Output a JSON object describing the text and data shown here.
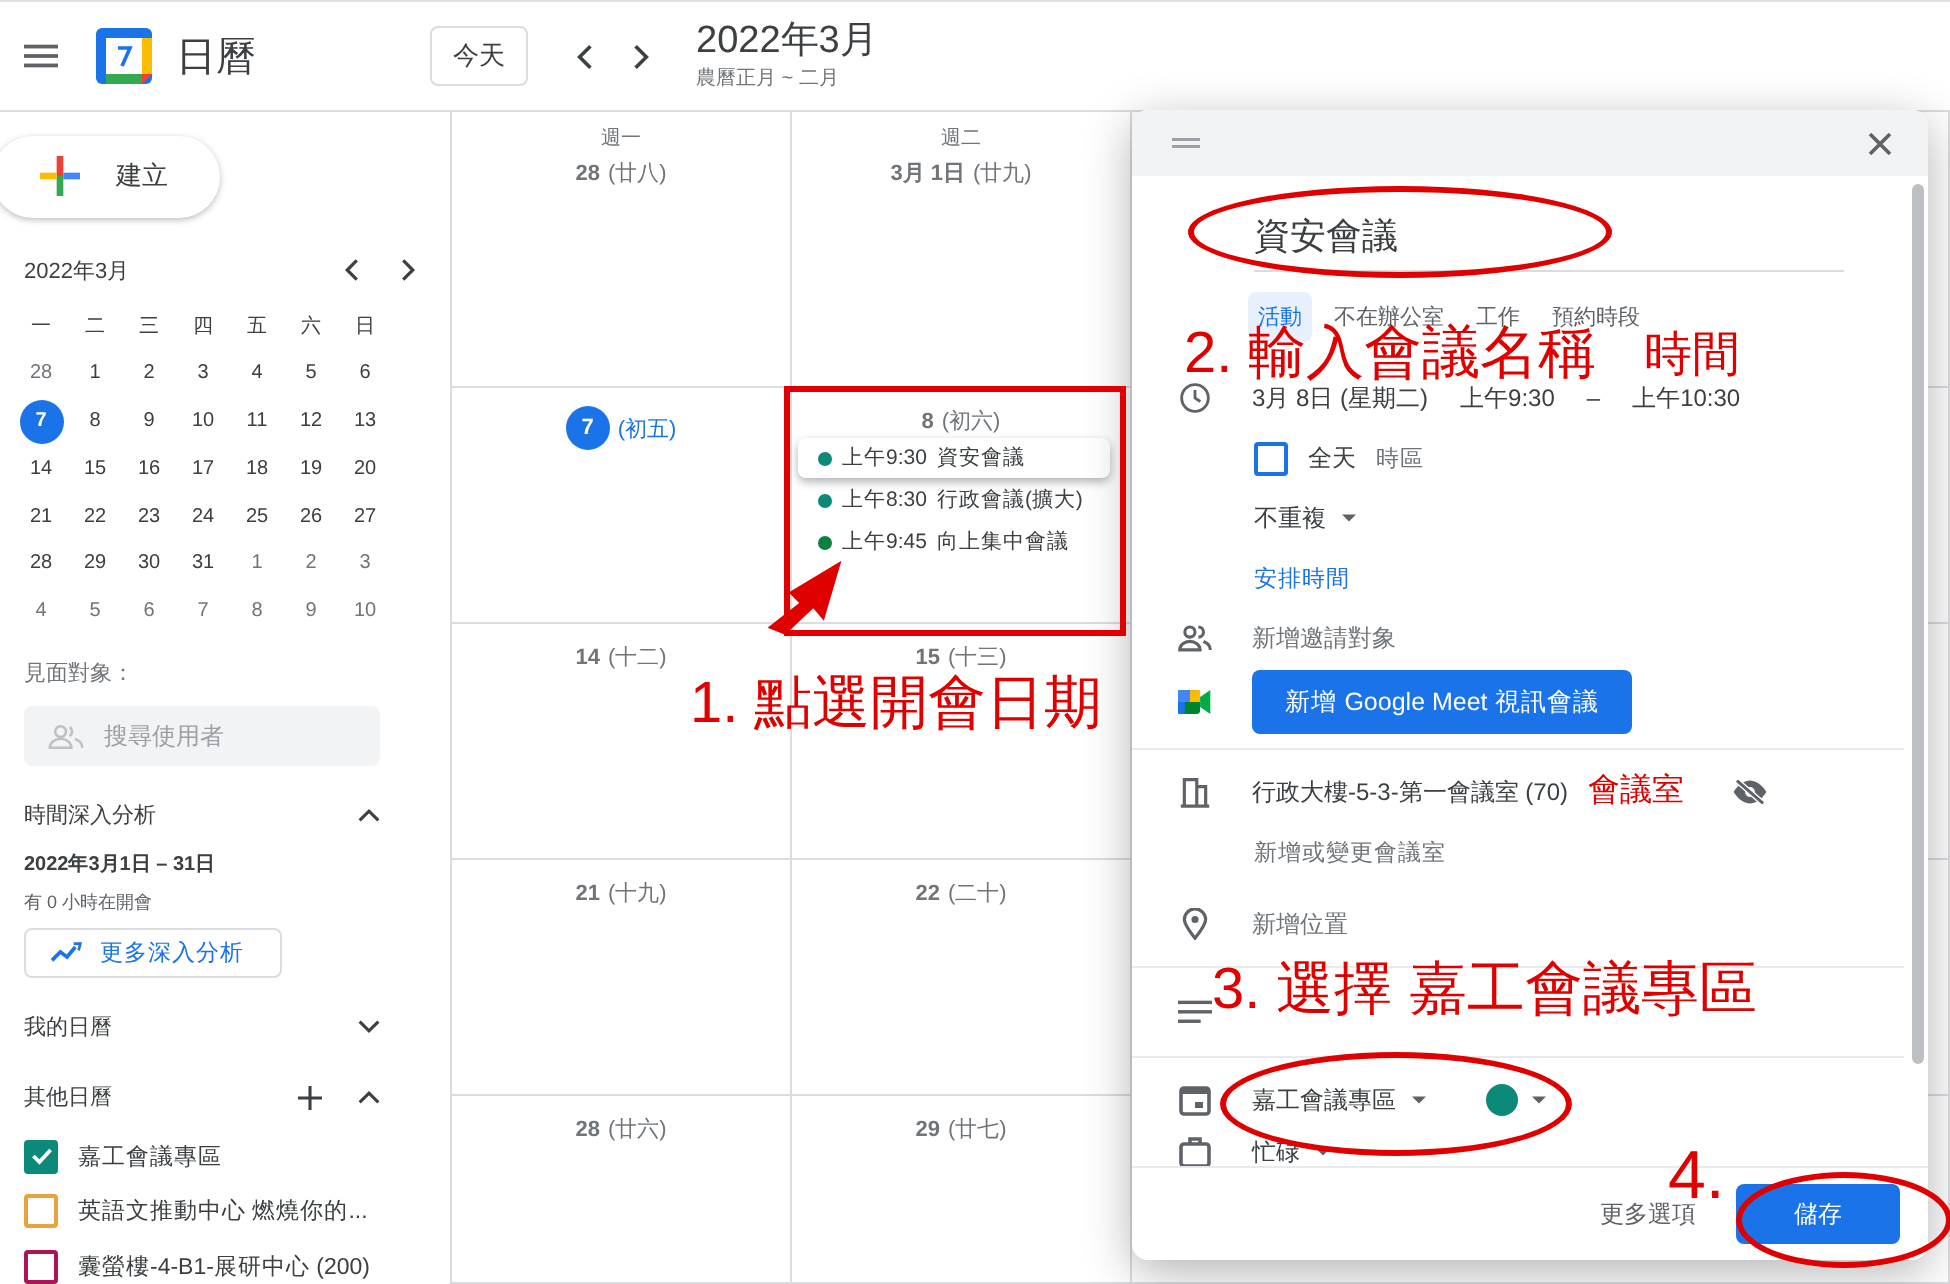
{
  "header": {
    "title": "日曆",
    "today_button": "今天",
    "month": "2022年3月",
    "lunar": "農曆正月 ~ 二月"
  },
  "sidebar": {
    "create_button": "建立",
    "mini_calendar": {
      "title": "2022年3月",
      "weekdays": [
        "一",
        "二",
        "三",
        "四",
        "五",
        "六",
        "日"
      ],
      "weeks": [
        [
          {
            "day": "28",
            "selected": false,
            "muted": true
          },
          {
            "day": "1",
            "selected": false,
            "muted": false
          },
          {
            "day": "2",
            "selected": false,
            "muted": false
          },
          {
            "day": "3",
            "selected": false,
            "muted": false
          },
          {
            "day": "4",
            "selected": false,
            "muted": false
          },
          {
            "day": "5",
            "selected": false,
            "muted": false
          },
          {
            "day": "6",
            "selected": false,
            "muted": false
          }
        ],
        [
          {
            "day": "7",
            "selected": true,
            "muted": false
          },
          {
            "day": "8",
            "selected": false,
            "muted": false
          },
          {
            "day": "9",
            "selected": false,
            "muted": false
          },
          {
            "day": "10",
            "selected": false,
            "muted": false
          },
          {
            "day": "11",
            "selected": false,
            "muted": false
          },
          {
            "day": "12",
            "selected": false,
            "muted": false
          },
          {
            "day": "13",
            "selected": false,
            "muted": false
          }
        ],
        [
          {
            "day": "14",
            "selected": false,
            "muted": false
          },
          {
            "day": "15",
            "selected": false,
            "muted": false
          },
          {
            "day": "16",
            "selected": false,
            "muted": false
          },
          {
            "day": "17",
            "selected": false,
            "muted": false
          },
          {
            "day": "18",
            "selected": false,
            "muted": false
          },
          {
            "day": "19",
            "selected": false,
            "muted": false
          },
          {
            "day": "20",
            "selected": false,
            "muted": false
          }
        ],
        [
          {
            "day": "21",
            "selected": false,
            "muted": false
          },
          {
            "day": "22",
            "selected": false,
            "muted": false
          },
          {
            "day": "23",
            "selected": false,
            "muted": false
          },
          {
            "day": "24",
            "selected": false,
            "muted": false
          },
          {
            "day": "25",
            "selected": false,
            "muted": false
          },
          {
            "day": "26",
            "selected": false,
            "muted": false
          },
          {
            "day": "27",
            "selected": false,
            "muted": false
          }
        ],
        [
          {
            "day": "28",
            "selected": false,
            "muted": false
          },
          {
            "day": "29",
            "selected": false,
            "muted": false
          },
          {
            "day": "30",
            "selected": false,
            "muted": false
          },
          {
            "day": "31",
            "selected": false,
            "muted": false
          },
          {
            "day": "1",
            "selected": false,
            "muted": true
          },
          {
            "day": "2",
            "selected": false,
            "muted": true
          },
          {
            "day": "3",
            "selected": false,
            "muted": true
          }
        ],
        [
          {
            "day": "4",
            "selected": false,
            "muted": true
          },
          {
            "day": "5",
            "selected": false,
            "muted": true
          },
          {
            "day": "6",
            "selected": false,
            "muted": true
          },
          {
            "day": "7",
            "selected": false,
            "muted": true
          },
          {
            "day": "8",
            "selected": false,
            "muted": true
          },
          {
            "day": "9",
            "selected": false,
            "muted": true
          },
          {
            "day": "10",
            "selected": false,
            "muted": true
          }
        ]
      ]
    },
    "people_search": {
      "label": "見面對象：",
      "placeholder": "搜尋使用者"
    },
    "insights": {
      "title": "時間深入分析",
      "expanded": true,
      "range": "2022年3月1日 – 31日",
      "summary": "有 0 小時在開會",
      "button": "更多深入分析"
    },
    "my_calendars": {
      "title": "我的日曆",
      "expanded": false
    },
    "other_calendars": {
      "title": "其他日曆",
      "expanded": true,
      "items": [
        {
          "name": "嘉工會議專區",
          "checked": true,
          "color": "#0b8a7a"
        },
        {
          "name": "英語文推動中心 燃燒你的...",
          "checked": false,
          "color": "#e8a33d"
        },
        {
          "name": "囊螢樓-4-B1-展研中心 (200)",
          "checked": false,
          "color": "#ad1457"
        }
      ]
    }
  },
  "calendar": {
    "weekday_headers": [
      "週一",
      "週二"
    ],
    "cells": [
      {
        "date": "28",
        "lunar": "(廿八)",
        "today": false
      },
      {
        "date": "3月 1日",
        "lunar": "(廿九)",
        "today": false
      },
      {
        "date": "7",
        "lunar": "(初五)",
        "today": true
      },
      {
        "date": "8",
        "lunar": "(初六)",
        "today": false,
        "events": [
          {
            "time": "上午9:30",
            "title": "資安會議",
            "color": "#0b8a7a",
            "selected": true
          },
          {
            "time": "上午8:30",
            "title": "行政會議(擴大)",
            "color": "#0b8a7a",
            "selected": false
          },
          {
            "time": "上午9:45",
            "title": "向上集中會議",
            "color": "#0b8043",
            "selected": false
          }
        ]
      },
      {
        "date": "14",
        "lunar": "(十二)",
        "today": false
      },
      {
        "date": "15",
        "lunar": "(十三)",
        "today": false
      },
      {
        "date": "21",
        "lunar": "(十九)",
        "today": false
      },
      {
        "date": "22",
        "lunar": "(二十)",
        "today": false
      },
      {
        "date": "28",
        "lunar": "(廿六)",
        "today": false
      },
      {
        "date": "29",
        "lunar": "(廿七)",
        "today": false
      }
    ]
  },
  "dialog": {
    "title_value": "資安會議",
    "types": [
      {
        "label": "活動",
        "selected": true
      },
      {
        "label": "不在辦公室",
        "selected": false
      },
      {
        "label": "工作",
        "selected": false
      },
      {
        "label": "預約時段",
        "selected": false
      }
    ],
    "date": "3月 8日 (星期二)",
    "start": "上午9:30",
    "dash": "–",
    "end": "上午10:30",
    "all_day": {
      "label": "全天",
      "checked": false
    },
    "timezone": "時區",
    "repeat": "不重複",
    "find_time": "安排時間",
    "guests_placeholder": "新增邀請對象",
    "meet_button": "新增 Google Meet 視訊會議",
    "room": "行政大樓-5-3-第一會議室 (70)",
    "room_change": "新增或變更會議室",
    "location_placeholder": "新增位置",
    "calendar": "嘉工會議專區",
    "busy": "忙碌",
    "more_options": "更多選項",
    "save": "儲存"
  },
  "annotations": [
    {
      "text": "1. 點選開會日期"
    },
    {
      "text": "2. 輸入會議名稱"
    },
    {
      "text": "時間"
    },
    {
      "text": "會議室"
    },
    {
      "text": "3. 選擇 嘉工會議專區"
    },
    {
      "text": "4."
    }
  ]
}
